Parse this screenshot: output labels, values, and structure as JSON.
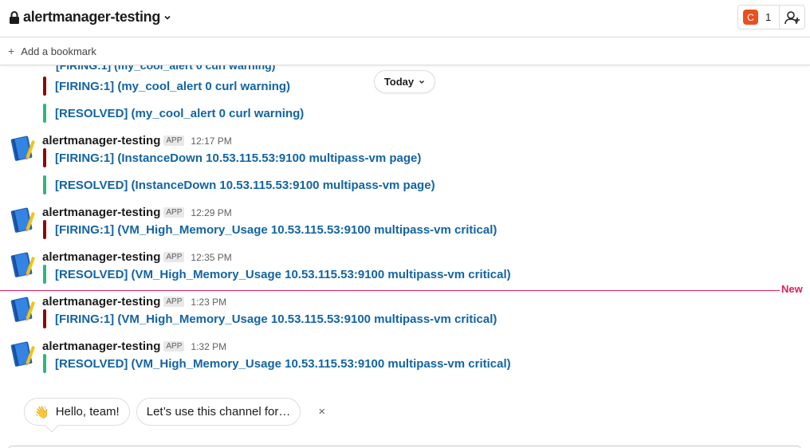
{
  "header": {
    "channel_name": "alertmanager-testing",
    "member_avatar_initial": "C",
    "member_count": "1"
  },
  "bookmark": {
    "label": "Add a bookmark"
  },
  "day_divider": {
    "label": "Today"
  },
  "bot_name": "alertmanager-testing",
  "app_badge": "APP",
  "clipped_previous": "[FIRING:1] (my_cool_alert 0 curl warning)",
  "messages": [
    {
      "attachments": [
        {
          "status": "firing",
          "text": "[FIRING:1]  (my_cool_alert 0 curl warning)"
        },
        {
          "status": "resolved",
          "text": "[RESOLVED]  (my_cool_alert 0 curl warning)"
        }
      ]
    },
    {
      "sender": "alertmanager-testing",
      "time": "12:17 PM",
      "attachments": [
        {
          "status": "firing",
          "text": "[FIRING:1]  (InstanceDown 10.53.115.53:9100 multipass-vm page)"
        },
        {
          "status": "resolved",
          "text": "[RESOLVED]  (InstanceDown 10.53.115.53:9100 multipass-vm page)"
        }
      ]
    },
    {
      "sender": "alertmanager-testing",
      "time": "12:29 PM",
      "attachments": [
        {
          "status": "firing",
          "text": "[FIRING:1]  (VM_High_Memory_Usage 10.53.115.53:9100 multipass-vm critical)"
        }
      ]
    },
    {
      "sender": "alertmanager-testing",
      "time": "12:35 PM",
      "attachments": [
        {
          "status": "resolved",
          "text": "[RESOLVED]  (VM_High_Memory_Usage 10.53.115.53:9100 multipass-vm critical)"
        }
      ]
    },
    {
      "sender": "alertmanager-testing",
      "time": "1:23 PM",
      "attachments": [
        {
          "status": "firing",
          "text": "[FIRING:1]  (VM_High_Memory_Usage 10.53.115.53:9100 multipass-vm critical)"
        }
      ]
    },
    {
      "sender": "alertmanager-testing",
      "time": "1:32 PM",
      "attachments": [
        {
          "status": "resolved",
          "text": "[RESOLVED]  (VM_High_Memory_Usage 10.53.115.53:9100 multipass-vm critical)"
        }
      ]
    }
  ],
  "new_divider": {
    "label": "New"
  },
  "suggestions": {
    "chip1_emoji": "👋",
    "chip1_label": "Hello, team!",
    "chip2_label": "Let’s use this channel for…",
    "close_label": "×"
  },
  "colors": {
    "firing": "#8b0a0a",
    "resolved": "#2eb67d",
    "link": "#1264a3",
    "new": "#e01e5a"
  }
}
